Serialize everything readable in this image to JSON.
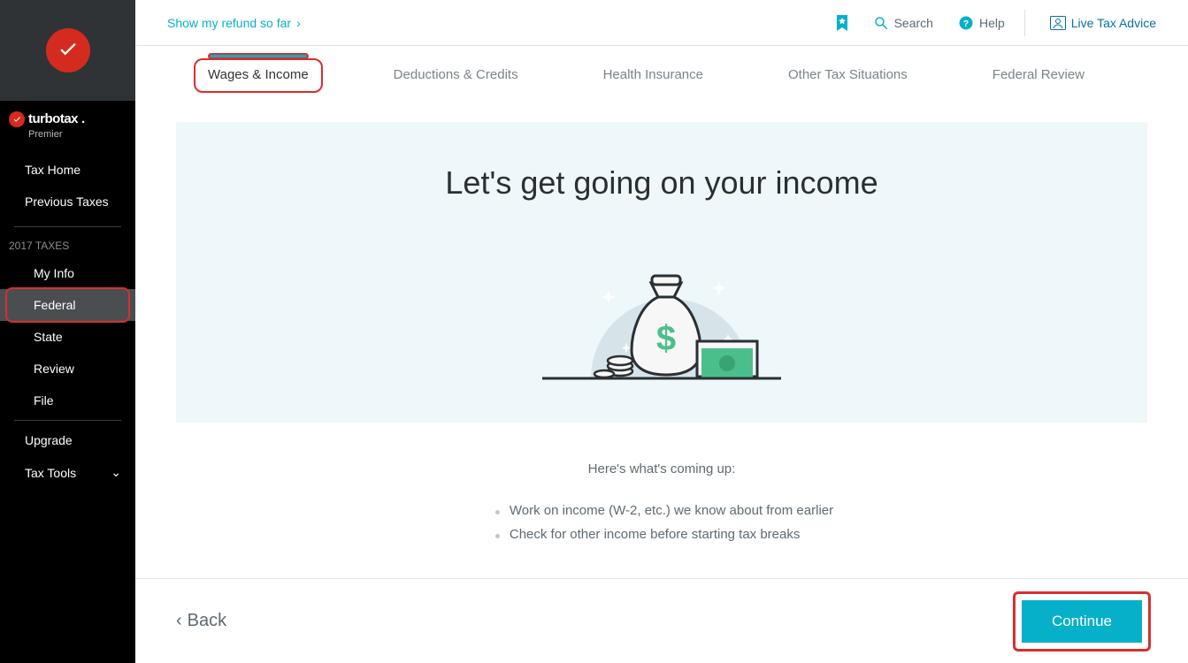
{
  "brand": {
    "name": "turbotax",
    "edition": "Premier"
  },
  "topbar": {
    "refund_link": "Show my refund so far",
    "search": "Search",
    "help": "Help",
    "live_advice": "Live Tax Advice"
  },
  "sidebar": {
    "tax_home": "Tax Home",
    "previous_taxes": "Previous Taxes",
    "section_label": "2017 TAXES",
    "items": {
      "my_info": "My Info",
      "federal": "Federal",
      "state": "State",
      "review": "Review",
      "file": "File"
    },
    "upgrade": "Upgrade",
    "tax_tools": "Tax Tools"
  },
  "tabs": {
    "wages_income": "Wages & Income",
    "deductions_credits": "Deductions & Credits",
    "health_insurance": "Health Insurance",
    "other_situations": "Other Tax Situations",
    "federal_review": "Federal Review"
  },
  "hero": {
    "title": "Let's get going on your income"
  },
  "coming_up": {
    "heading": "Here's what's coming up:",
    "bullets": [
      "Work on income (W-2, etc.) we know about from earlier",
      "Check for other income before starting tax breaks"
    ]
  },
  "footer": {
    "back": "Back",
    "continue": "Continue"
  }
}
